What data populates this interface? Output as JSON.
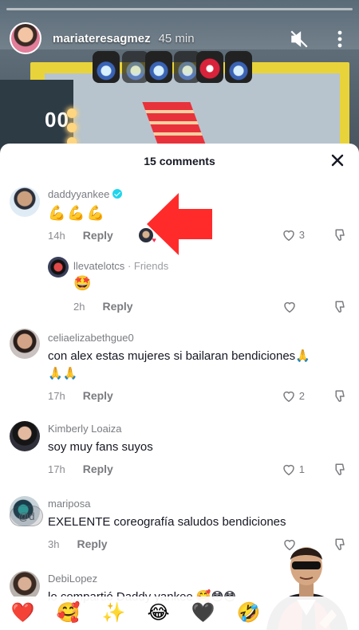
{
  "story": {
    "username": "mariateresagmez",
    "time_ago": "45 min",
    "stage_sign": "00"
  },
  "comments_sheet": {
    "title": "15 comments",
    "comments": [
      {
        "username": "daddyyankee",
        "verified": true,
        "text": "💪💪💪",
        "time": "14h",
        "reply_label": "Reply",
        "likes": "3",
        "creator_liked": true
      },
      {
        "username": "llevatelotcs",
        "tag": "· Friends",
        "text": "🤩",
        "time": "2h",
        "reply_label": "Reply",
        "likes": ""
      },
      {
        "username": "celiaelizabethgue0",
        "text": "con alex estas mujeres si bailaran bendiciones🙏",
        "text_line2": "🙏🙏",
        "time": "17h",
        "reply_label": "Reply",
        "likes": "2"
      },
      {
        "username": "Kimberly Loaiza",
        "text": "soy muy fans suyos",
        "time": "17h",
        "reply_label": "Reply",
        "likes": "1"
      },
      {
        "username": "mariposa",
        "text": "EXELENTE coreografía saludos bendiciones",
        "time": "3h",
        "reply_label": "Reply",
        "likes": ""
      },
      {
        "username": "DebiLopez",
        "text": "lo compartió Daddy yankee 🥰😳😳"
      }
    ]
  },
  "mention_chip": "@d",
  "reactions": [
    "❤️",
    "🥰",
    "✨",
    "😂",
    "🖤",
    "🤣"
  ],
  "colors": {
    "arrow": "#ff2b2b",
    "verified": "#20d5ec",
    "text_primary": "#161823",
    "text_secondary": "#7a7c82"
  },
  "icons": [
    "mute-icon",
    "more-icon",
    "close-icon",
    "heart-outline-icon",
    "dislike-icon",
    "verified-badge-icon"
  ]
}
